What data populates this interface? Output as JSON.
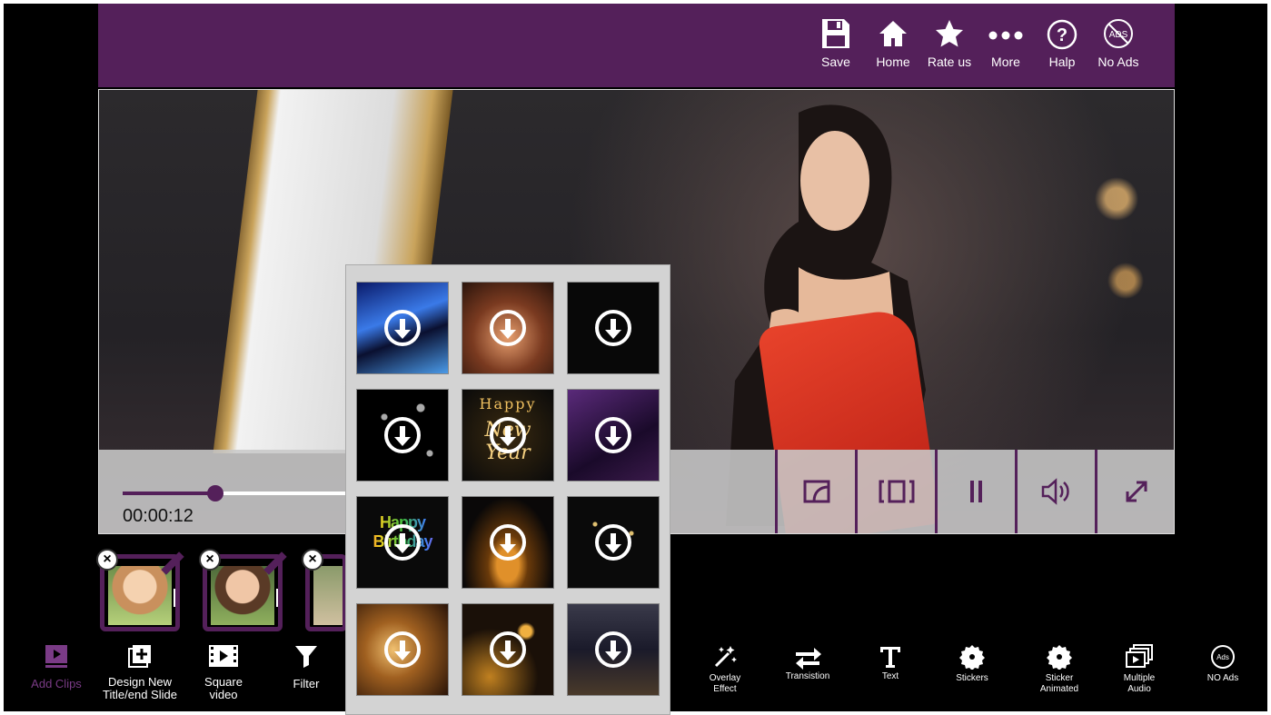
{
  "header": {
    "buttons": [
      {
        "label": "Save",
        "icon": "floppy-disk-icon"
      },
      {
        "label": "Home",
        "icon": "home-icon"
      },
      {
        "label": "Rate us",
        "icon": "star-icon"
      },
      {
        "label": "More",
        "icon": "more-dots-icon"
      },
      {
        "label": "Halp",
        "icon": "help-icon"
      },
      {
        "label": "No Ads",
        "icon": "no-ads-icon"
      }
    ],
    "no_ads_badge": "ADS"
  },
  "player": {
    "timecode": "00:00:12",
    "progress_fraction": 0.3,
    "controls": [
      "crop-icon",
      "aspect-ratio-icon",
      "pause-icon",
      "volume-icon",
      "fullscreen-icon"
    ]
  },
  "clips": {
    "count_visible": 3
  },
  "toolbar": {
    "left": [
      {
        "label": "Add Clips",
        "icon": "add-clips-icon",
        "active": true
      },
      {
        "label": "Design New Title/end Slide",
        "icon": "add-slide-icon"
      },
      {
        "label": "Square video",
        "icon": "square-video-icon"
      },
      {
        "label": "Filter",
        "icon": "filter-icon"
      }
    ],
    "right": [
      {
        "label": "Overlay Effect",
        "icon": "magic-wand-icon"
      },
      {
        "label": "Transistion",
        "icon": "transition-arrows-icon"
      },
      {
        "label": "Text",
        "icon": "text-icon"
      },
      {
        "label": "Stickers",
        "icon": "sticker-icon"
      },
      {
        "label": "Sticker Animated",
        "icon": "sticker-animated-icon"
      },
      {
        "label": "Multiple Audio",
        "icon": "multiple-audio-icon"
      },
      {
        "label": "NO Ads",
        "icon": "no-ads-icon"
      }
    ],
    "no_ads_badge": "Ads"
  },
  "overlay_popup": {
    "thumb_texts": {
      "happy_new_year_top": "Happy",
      "happy_new_year_bottom": "New Year",
      "happy_birthday": "Happy Birthday"
    }
  },
  "colors": {
    "brand": "#54205a",
    "active_tool": "#7a3b86"
  }
}
